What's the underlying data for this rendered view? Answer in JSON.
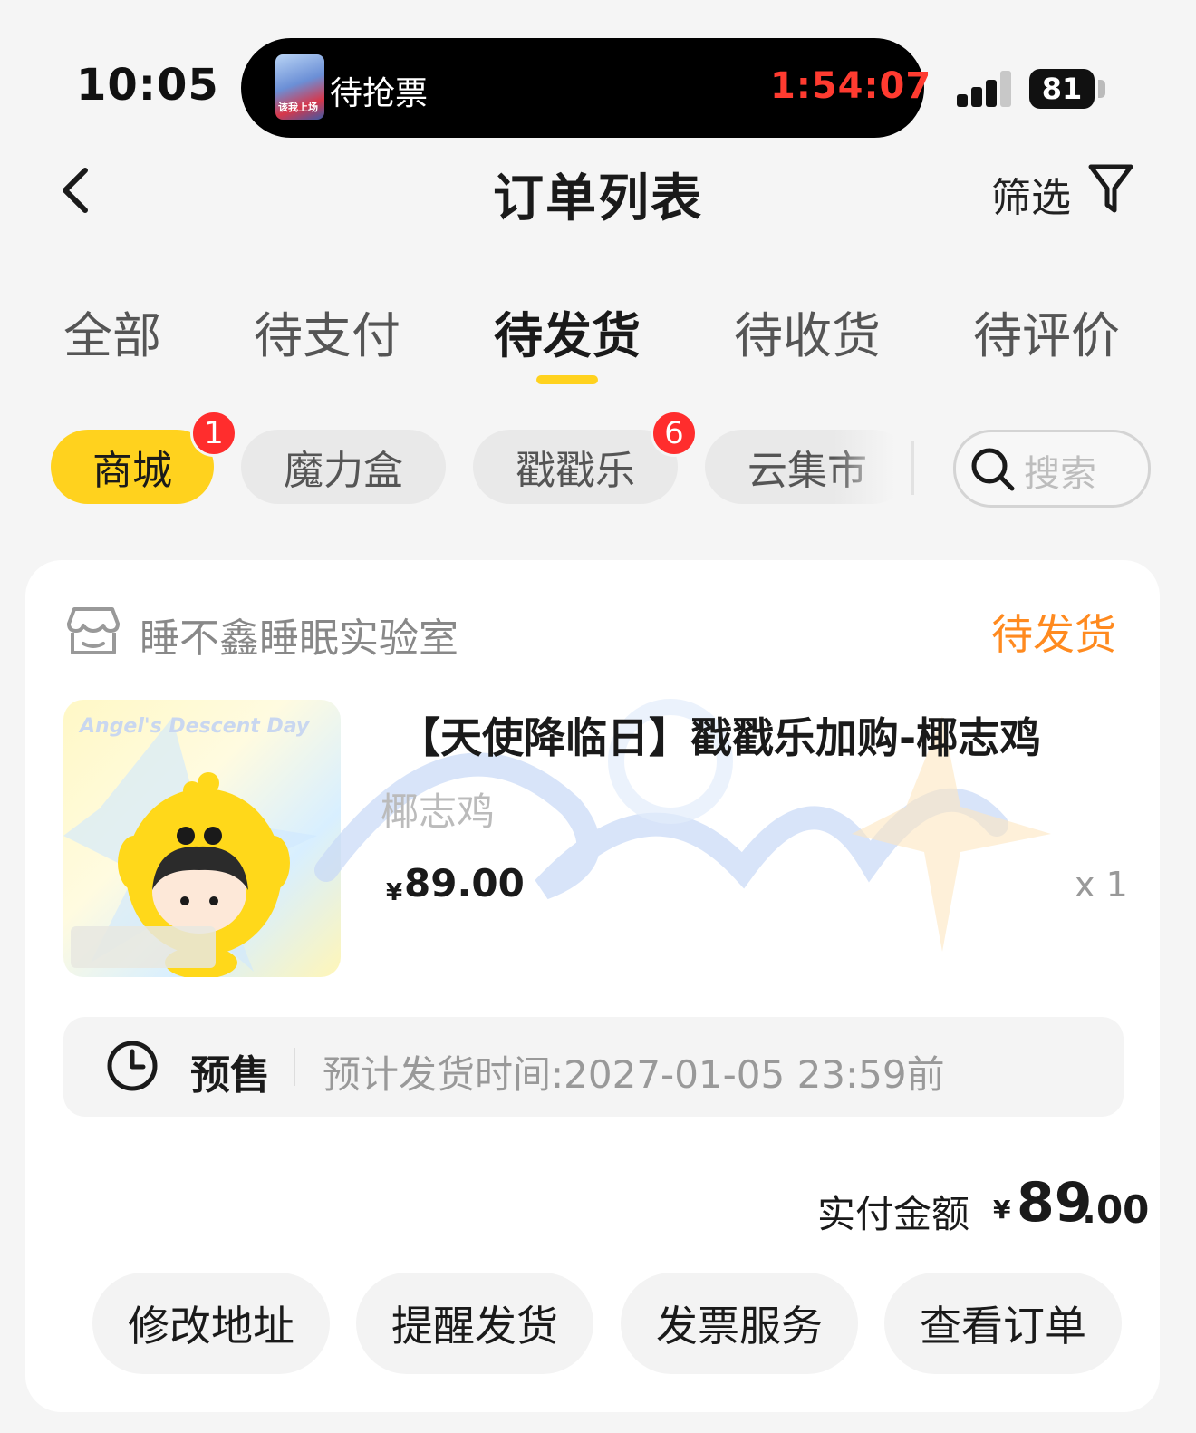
{
  "status_bar": {
    "time": "10:05",
    "live_activity": {
      "thumbnail_text": "该我上场",
      "title": "待抢票",
      "countdown": "1:54:07"
    },
    "battery": "81"
  },
  "nav": {
    "title": "订单列表",
    "filter_label": "筛选",
    "back_icon": "chevron-left-icon",
    "filter_icon": "funnel-icon"
  },
  "tabs": [
    {
      "label": "全部"
    },
    {
      "label": "待支付"
    },
    {
      "label": "待发货",
      "active": true
    },
    {
      "label": "待收货"
    },
    {
      "label": "待评价"
    }
  ],
  "chips": [
    {
      "label": "商城",
      "badge": "1",
      "active": true
    },
    {
      "label": "魔力盒"
    },
    {
      "label": "戳戳乐",
      "badge": "6"
    },
    {
      "label": "云集市"
    }
  ],
  "search": {
    "placeholder": "搜索"
  },
  "order": {
    "store_name": "睡不鑫睡眠实验室",
    "status": "待发货",
    "product": {
      "image_text": "Angel's Descent Day",
      "name": "【天使降临日】戳戳乐加购-椰志鸡",
      "spec": "椰志鸡",
      "currency": "¥",
      "price": "89.00",
      "quantity": "x 1"
    },
    "presale": {
      "label": "预售",
      "text": "预计发货时间:2027-01-05 23:59前"
    },
    "paid": {
      "label": "实付金额",
      "currency": "¥",
      "integer": "89",
      "decimal": ".00"
    },
    "actions": [
      "修改地址",
      "提醒发货",
      "发票服务",
      "查看订单"
    ]
  },
  "colors": {
    "accent": "#ffd21e",
    "status_orange": "#ff8a1f",
    "badge_red": "#ff2d2d",
    "timer_red": "#ff3b30"
  }
}
